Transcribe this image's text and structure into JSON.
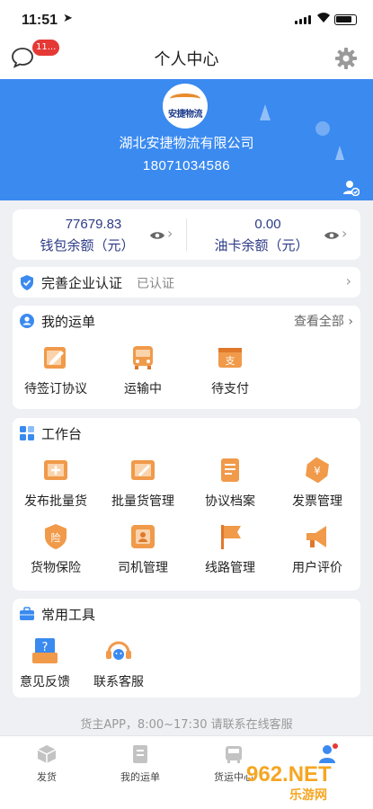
{
  "status_bar": {
    "time": "11:51",
    "location_icon": "location-arrow-icon"
  },
  "nav": {
    "title": "个人中心",
    "message_badge": "11...",
    "message_icon": "chat-bubble-icon",
    "settings_icon": "gear-icon"
  },
  "profile": {
    "logo_text": "安捷物流",
    "company": "湖北安捷物流有限公司",
    "phone": "18071034586"
  },
  "balance": {
    "wallet_value": "77679.83",
    "wallet_label": "钱包余额（元）",
    "fuel_value": "0.00",
    "fuel_label": "油卡余额（元）"
  },
  "verification": {
    "title": "完善企业认证",
    "status": "已认证"
  },
  "orders": {
    "title": "我的运单",
    "more": "查看全部",
    "items": [
      {
        "label": "待签订协议",
        "icon": "contract-sign-icon"
      },
      {
        "label": "运输中",
        "icon": "truck-icon"
      },
      {
        "label": "待支付",
        "icon": "payment-icon"
      }
    ]
  },
  "workbench": {
    "title": "工作台",
    "items": [
      {
        "label": "发布批量货",
        "icon": "publish-cargo-icon"
      },
      {
        "label": "批量货管理",
        "icon": "cargo-manage-icon"
      },
      {
        "label": "协议档案",
        "icon": "agreement-archive-icon"
      },
      {
        "label": "发票管理",
        "icon": "invoice-icon"
      },
      {
        "label": "货物保险",
        "icon": "insurance-icon"
      },
      {
        "label": "司机管理",
        "icon": "driver-icon"
      },
      {
        "label": "线路管理",
        "icon": "route-flag-icon"
      },
      {
        "label": "用户评价",
        "icon": "megaphone-icon"
      }
    ]
  },
  "tools": {
    "title": "常用工具",
    "items": [
      {
        "label": "意见反馈",
        "icon": "feedback-icon"
      },
      {
        "label": "联系客服",
        "icon": "headset-icon"
      }
    ]
  },
  "footnote": "货主APP，8:00~17:30 请联系在线客服",
  "tabbar": {
    "tabs": [
      {
        "label": "发货",
        "icon": "box-icon"
      },
      {
        "label": "我的运单",
        "icon": "orders-icon"
      },
      {
        "label": "货运中心",
        "icon": "truck-tab-icon"
      },
      {
        "label": "",
        "icon": "profile-tab-icon"
      }
    ]
  },
  "watermark": {
    "brand": "962.NET",
    "sub": "乐游网"
  },
  "colors": {
    "primary": "#3a8af0",
    "accent_orange": "#f09a4a",
    "navy_text": "#2d3b86"
  }
}
